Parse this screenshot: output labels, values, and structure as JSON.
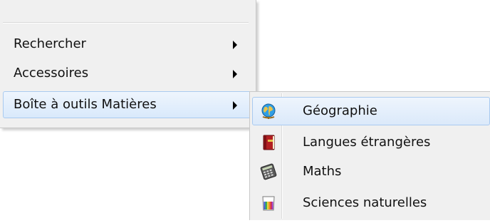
{
  "main_menu": {
    "items": [
      {
        "label": "Rechercher"
      },
      {
        "label": "Accessoires"
      },
      {
        "label": "Boîte à outils Matières"
      }
    ]
  },
  "submenu": {
    "items": [
      {
        "label": "Géographie",
        "icon": "globe-icon"
      },
      {
        "label": "Langues étrangères",
        "icon": "book-icon"
      },
      {
        "label": "Maths",
        "icon": "calculator-icon"
      },
      {
        "label": "Sciences naturelles",
        "icon": "beaker-icon"
      }
    ]
  },
  "colors": {
    "menu_bg": "#f0f0f0",
    "highlight_border": "#a9caf0",
    "highlight_bg": "#dbe9fa"
  }
}
